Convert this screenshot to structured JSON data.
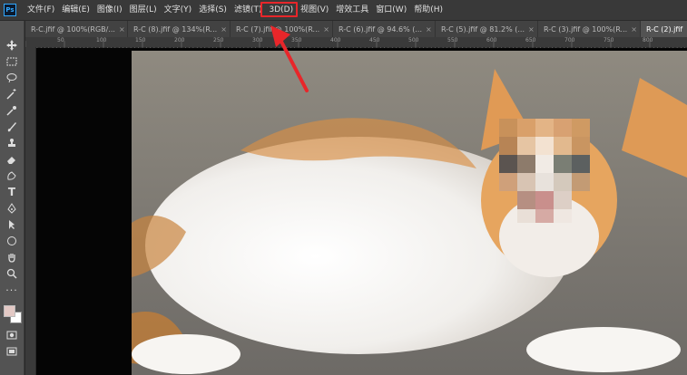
{
  "app": {
    "logo_text": "Ps"
  },
  "menu": [
    {
      "id": "file",
      "label": "文件(F)"
    },
    {
      "id": "edit",
      "label": "编辑(E)"
    },
    {
      "id": "image",
      "label": "图像(I)"
    },
    {
      "id": "layer",
      "label": "图层(L)"
    },
    {
      "id": "type",
      "label": "文字(Y)"
    },
    {
      "id": "select",
      "label": "选择(S)"
    },
    {
      "id": "filter",
      "label": "滤镜(T)"
    },
    {
      "id": "3d",
      "label": "3D(D)"
    },
    {
      "id": "view",
      "label": "视图(V)"
    },
    {
      "id": "plugins",
      "label": "增效工具"
    },
    {
      "id": "window",
      "label": "窗口(W)"
    },
    {
      "id": "help",
      "label": "帮助(H)"
    }
  ],
  "tabs": [
    {
      "label": "R-C.jfif @ 100%(RGB/...",
      "active": false
    },
    {
      "label": "R-C (8).jfif @ 134%(R...",
      "active": false
    },
    {
      "label": "R-C (7).jfif @ 100%(R...",
      "active": false
    },
    {
      "label": "R-C (6).jfif @ 94.6% (...",
      "active": false
    },
    {
      "label": "R-C (5).jfif @ 81.2% (...",
      "active": false
    },
    {
      "label": "R-C (3).jfif @ 100%(R...",
      "active": false
    },
    {
      "label": "R-C (2).jfif",
      "active": true
    }
  ],
  "ruler_labels": [
    "50",
    "100",
    "150",
    "200",
    "250",
    "300",
    "350",
    "400",
    "450",
    "500",
    "550",
    "600",
    "650",
    "700",
    "750",
    "800",
    "850"
  ],
  "colors": {
    "accent_annotation": "#e8262a",
    "foreground": "#e3c9c5",
    "background": "#ffffff"
  },
  "toolbar_icons": [
    "move-icon",
    "marquee-icon",
    "lasso-icon",
    "magic-wand-icon",
    "eyedropper-icon",
    "brush-icon",
    "stamp-icon",
    "eraser-icon",
    "gradient-icon",
    "dodge-icon",
    "type-icon",
    "pen-icon",
    "path-select-icon",
    "shape-icon",
    "hand-icon",
    "zoom-icon",
    "more-icon"
  ]
}
